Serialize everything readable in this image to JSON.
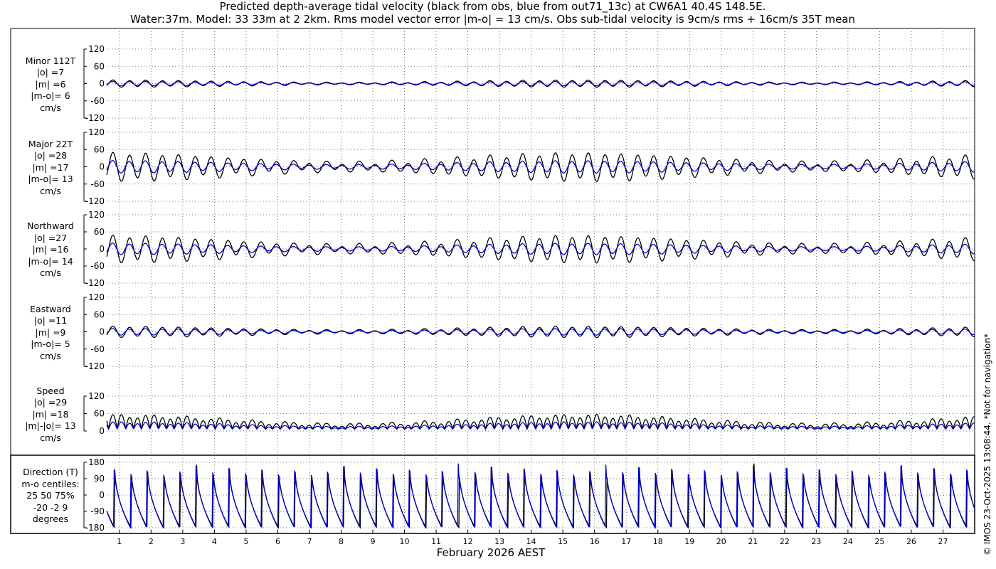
{
  "title": {
    "line1": "Predicted depth-average tidal velocity (black from obs, blue from out71_13c) at CW6A1 40.4S 148.5E.",
    "line2": "Water:37m. Model: 33 33m at 2 2km. Rms model vector error |m-o| = 13 cm/s. Obs sub-tidal velocity is 9cm/s rms + 16cm/s 35T mean"
  },
  "copyright": "© IMOS 23-Oct-2025 13:08:44. *Not for navigation*",
  "colors": {
    "obs": "#000000",
    "model": "#0000cc",
    "grid": "#555555"
  },
  "chart_data": {
    "type": "line",
    "xlabel": "February 2026 AEST",
    "x_ticks": [
      "1",
      "2",
      "3",
      "4",
      "5",
      "6",
      "7",
      "8",
      "9",
      "10",
      "11",
      "12",
      "13",
      "14",
      "15",
      "16",
      "17",
      "18",
      "19",
      "20",
      "21",
      "22",
      "23",
      "24",
      "25",
      "26",
      "27"
    ],
    "xlim": [
      0.6,
      28.0
    ],
    "grid": true,
    "series_legend": {
      "obs": "black from obs",
      "model": "blue from out71_13c"
    },
    "panels": [
      {
        "name": "minor",
        "label": [
          "Minor 112T",
          "|o| =7",
          "|m| =6",
          "|m-o|= 6",
          "cm/s"
        ],
        "ylim": [
          -120,
          120
        ],
        "yticks": [
          -120,
          -60,
          0,
          60,
          120
        ],
        "tick_labels": [
          "-120",
          "-60",
          "0",
          "60",
          "120"
        ],
        "obs_amplitude": 7,
        "model_amplitude": 6
      },
      {
        "name": "major",
        "label": [
          "Major 22T",
          "|o| =28",
          "|m| =17",
          "|m-o|= 13",
          "cm/s"
        ],
        "ylim": [
          -120,
          120
        ],
        "yticks": [
          -120,
          -60,
          0,
          60,
          120
        ],
        "tick_labels": [
          "-120",
          "-60",
          "0",
          "60",
          "120"
        ],
        "obs_amplitude": 28,
        "model_amplitude": 17
      },
      {
        "name": "northward",
        "label": [
          "Northward",
          "|o| =27",
          "|m| =16",
          "|m-o|= 14",
          "cm/s"
        ],
        "ylim": [
          -120,
          120
        ],
        "yticks": [
          -120,
          -60,
          0,
          60,
          120
        ],
        "tick_labels": [
          "-120",
          "-60",
          "0",
          "60",
          "120"
        ],
        "obs_amplitude": 27,
        "model_amplitude": 16
      },
      {
        "name": "eastward",
        "label": [
          "Eastward",
          "|o| =11",
          "|m| =9",
          "|m-o|= 5",
          "cm/s"
        ],
        "ylim": [
          -120,
          120
        ],
        "yticks": [
          -120,
          -60,
          0,
          60,
          120
        ],
        "tick_labels": [
          "-120",
          "-60",
          "0",
          "60",
          "120"
        ],
        "obs_amplitude": 11,
        "model_amplitude": 9
      },
      {
        "name": "speed",
        "label": [
          "Speed",
          "|o| =29",
          "|m| =18",
          "|m|-|o|= 13",
          "cm/s"
        ],
        "ylim": [
          0,
          120
        ],
        "yticks": [
          0,
          60,
          120
        ],
        "tick_labels": [
          "0",
          "60",
          "120"
        ],
        "obs_amplitude": 29,
        "model_amplitude": 18
      },
      {
        "name": "direction",
        "label": [
          "Direction (T)",
          "m-o centiles:",
          "25  50  75%",
          "-20  -2   9",
          "degrees"
        ],
        "ylim": [
          -180,
          180
        ],
        "yticks": [
          -180,
          -90,
          0,
          90,
          180
        ],
        "tick_labels": [
          "-180",
          "-90",
          "0",
          "90",
          "180"
        ]
      }
    ]
  }
}
